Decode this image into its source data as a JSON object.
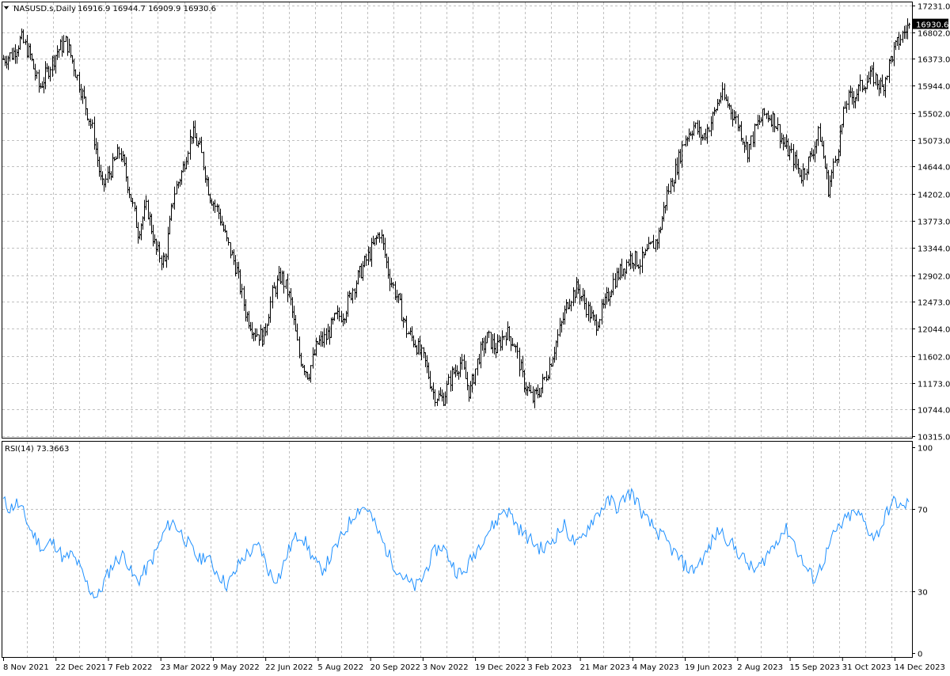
{
  "colors": {
    "background": "#ffffff",
    "grid": "#c0c0c0",
    "bars": "#000000",
    "rsi_line": "#1e90ff",
    "price_label_bg": "#000000",
    "price_label_text": "#ffffff"
  },
  "header": {
    "arrow_icon": "triangle-down-icon",
    "symbol": "NASUSD.s,Daily",
    "ohlc": "16916.9 16944.7 16909.9 16930.6"
  },
  "rsi_header": {
    "label": "RSI(14) 73.3663"
  },
  "current_price": {
    "value": 16930.6,
    "label": "16930.6"
  },
  "chart_data": [
    {
      "type": "ohlc",
      "grid": true,
      "ylim": [
        10315.0,
        17231.0
      ],
      "y_ticks": [
        "17231.0",
        "16802.0",
        "16373.0",
        "15944.0",
        "15502.0",
        "15073.0",
        "14644.0",
        "14202.0",
        "13773.0",
        "13344.0",
        "12902.0",
        "12473.0",
        "12044.0",
        "11602.0",
        "11173.0",
        "10744.0",
        "10315.0"
      ],
      "x_tick_labels": [
        "8 Nov 2021",
        "22 Dec 2021",
        "7 Feb 2022",
        "23 Mar 2022",
        "9 May 2022",
        "22 Jun 2022",
        "5 Aug 2022",
        "20 Sep 2022",
        "3 Nov 2022",
        "19 Dec 2022",
        "3 Feb 2023",
        "21 Mar 2023",
        "4 May 2023",
        "19 Jun 2023",
        "2 Aug 2023",
        "15 Sep 2023",
        "31 Oct 2023",
        "14 Dec 2023"
      ],
      "closes_approx": [
        16370,
        16450,
        16700,
        16420,
        15900,
        16200,
        16500,
        16650,
        16200,
        15700,
        15200,
        14300,
        14600,
        14900,
        14300,
        13600,
        14000,
        13300,
        13100,
        14200,
        14600,
        15200,
        14900,
        14200,
        13900,
        13400,
        13000,
        12300,
        12000,
        11900,
        12600,
        12900,
        12500,
        11600,
        11300,
        11800,
        11900,
        12200,
        12300,
        12700,
        13000,
        13300,
        13600,
        12900,
        12500,
        12000,
        11800,
        11500,
        11000,
        10900,
        11300,
        11500,
        11000,
        11600,
        11900,
        11700,
        12000,
        11800,
        11200,
        10900,
        11100,
        11500,
        12000,
        12500,
        12700,
        12400,
        12100,
        12400,
        12800,
        13000,
        13200,
        13100,
        13300,
        13500,
        14200,
        14600,
        15100,
        15300,
        15100,
        15400,
        15800,
        15600,
        15300,
        14900,
        15300,
        15500,
        15400,
        15000,
        14800,
        14500,
        14800,
        15200,
        14300,
        14900,
        15700,
        15800,
        16000,
        16100,
        15900,
        16400,
        16700,
        16930.6
      ]
    },
    {
      "type": "line",
      "grid": true,
      "ylim": [
        0,
        100
      ],
      "y_ticks": [
        100,
        70,
        30,
        0
      ],
      "values_approx": [
        74,
        70,
        73,
        68,
        60,
        55,
        50,
        54,
        52,
        45,
        48,
        44,
        36,
        30,
        27,
        35,
        42,
        46,
        48,
        38,
        35,
        40,
        45,
        52,
        60,
        64,
        60,
        55,
        50,
        45,
        48,
        42,
        38,
        33,
        37,
        44,
        48,
        50,
        52,
        42,
        36,
        38,
        48,
        55,
        58,
        52,
        45,
        40,
        44,
        50,
        56,
        62,
        68,
        71,
        70,
        62,
        55,
        48,
        42,
        38,
        34,
        32,
        36,
        44,
        50,
        52,
        46,
        40,
        38,
        44,
        50,
        56,
        60,
        64,
        70,
        68,
        62,
        58,
        55,
        52,
        50,
        54,
        58,
        62,
        56,
        52,
        58,
        64,
        68,
        72,
        74,
        70,
        76,
        78,
        72,
        65,
        62,
        58,
        55,
        50,
        46,
        42,
        40,
        44,
        48,
        55,
        60,
        56,
        52,
        48,
        44,
        40,
        42,
        48,
        52,
        58,
        60,
        54,
        46,
        40,
        36,
        42,
        50,
        58,
        62,
        66,
        68,
        66,
        60,
        56,
        62,
        70,
        74,
        70,
        73.37
      ]
    }
  ]
}
